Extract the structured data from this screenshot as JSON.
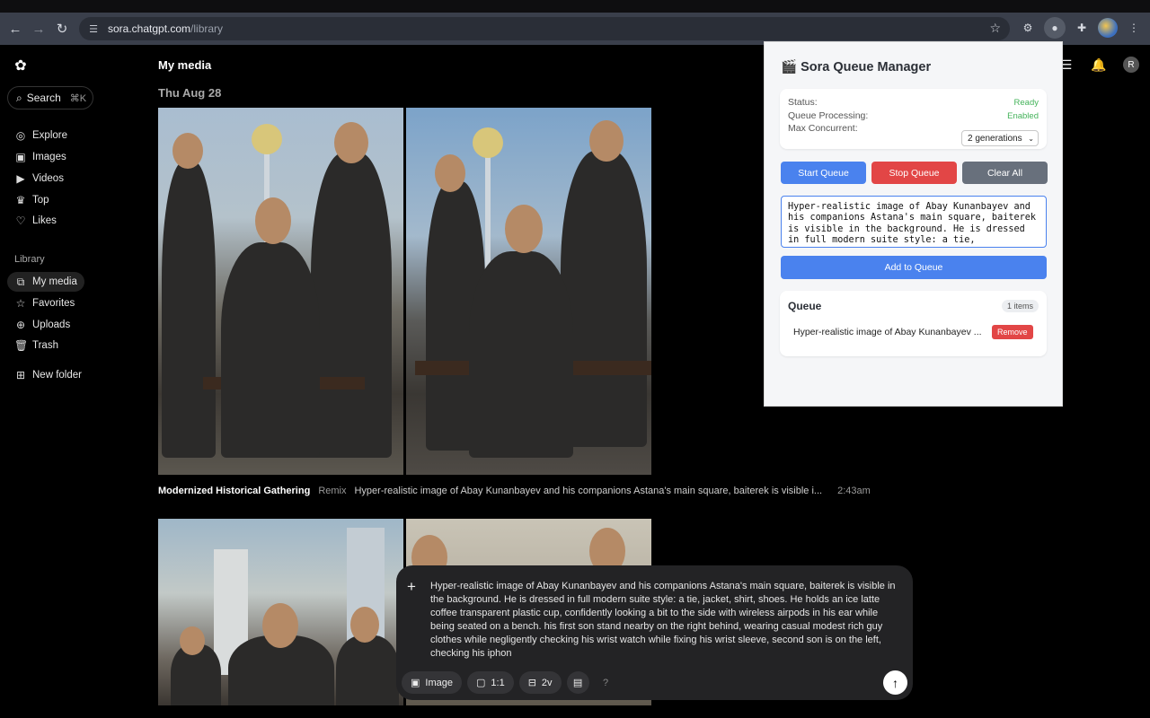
{
  "browser": {
    "url_host": "sora.chatgpt.com",
    "url_path": "/library",
    "icons": [
      "back-icon",
      "forward-icon",
      "reload-icon",
      "site-settings-icon",
      "bookmark-star-icon",
      "extension-icon",
      "extensions-puzzle-icon",
      "more-icon"
    ]
  },
  "sidebar": {
    "search_label": "Search",
    "search_shortcut": "⌘K",
    "nav": [
      {
        "label": "Explore",
        "icon": "compass-icon"
      },
      {
        "label": "Images",
        "icon": "image-icon"
      },
      {
        "label": "Videos",
        "icon": "video-icon"
      },
      {
        "label": "Top",
        "icon": "trophy-icon"
      },
      {
        "label": "Likes",
        "icon": "heart-icon"
      }
    ],
    "library_label": "Library",
    "library": [
      {
        "label": "My media",
        "icon": "media-icon",
        "active": true
      },
      {
        "label": "Favorites",
        "icon": "star-icon"
      },
      {
        "label": "Uploads",
        "icon": "upload-icon"
      },
      {
        "label": "Trash",
        "icon": "trash-icon"
      }
    ],
    "new_folder_label": "New folder"
  },
  "main": {
    "title": "My media",
    "date": "Thu Aug 28",
    "caption": {
      "title": "Modernized Historical Gathering",
      "tag": "Remix",
      "prompt": "Hyper-realistic image of Abay Kunanbayev and his companions Astana's main square, baiterek is visible i...",
      "time": "2:43am"
    }
  },
  "composer": {
    "prompt": "Hyper-realistic image of Abay Kunanbayev and his companions Astana's main square, baiterek is visible in the background. He is dressed in full modern suite style: a tie, jacket, shirt, shoes. He holds an ice latte  coffee transparent plastic cup, confidently looking a bit to the side with wireless airpods in his ear while being seated on a bench. his first son  stand nearby on the right behind, wearing casual modest rich guy clothes while negligently checking his wrist watch while fixing his wrist sleeve, second son is on the left, checking his iphon",
    "type_label": "Image",
    "aspect_label": "1:1",
    "variations_label": "2v",
    "help_label": "?"
  },
  "topbar": {
    "avatar_initial": "R"
  },
  "extension": {
    "title": "🎬 Sora Queue Manager",
    "status_label": "Status:",
    "status_value": "Ready",
    "processing_label": "Queue Processing:",
    "processing_value": "Enabled",
    "concurrent_label": "Max Concurrent:",
    "concurrent_value": "2 generations",
    "start_label": "Start Queue",
    "stop_label": "Stop Queue",
    "clear_label": "Clear All",
    "prompt_text": "Hyper-realistic image of Abay Kunanbayev and his companions Astana's main square, baiterek is visible in the background. He is dressed in full modern suite style: a tie,",
    "add_label": "Add to Queue",
    "queue_title": "Queue",
    "queue_count": "1 items",
    "queue_items": [
      {
        "text": "Hyper-realistic image of Abay Kunanbayev ...",
        "remove_label": "Remove"
      }
    ],
    "colors": {
      "primary": "#4a82ee",
      "danger": "#e24646",
      "neutral": "#68707c",
      "ok": "#44b35a"
    }
  }
}
